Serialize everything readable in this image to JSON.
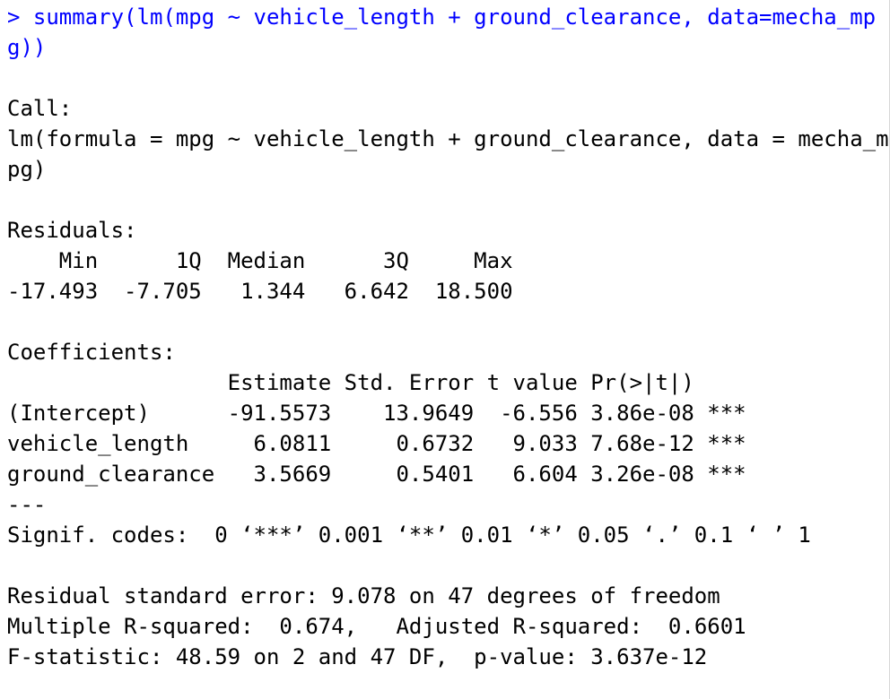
{
  "console": {
    "command_line_1": "> summary(lm(mpg ~ vehicle_length + ground_clearance, data=mecha_mp",
    "command_line_2": "g))",
    "call_header": "Call:",
    "call_line_1": "lm(formula = mpg ~ vehicle_length + ground_clearance, data = mecha_m",
    "call_line_2": "pg)",
    "residuals_header": "Residuals:",
    "residuals_labels": "    Min      1Q  Median      3Q     Max ",
    "residuals_values": "-17.493  -7.705   1.344   6.642  18.500 ",
    "coefficients_header": "Coefficients:",
    "coef_columns": "                 Estimate Std. Error t value Pr(>|t|)    ",
    "coef_rows": [
      "(Intercept)      -91.5573    13.9649  -6.556 3.86e-08 ***",
      "vehicle_length     6.0811     0.6732   9.033 7.68e-12 ***",
      "ground_clearance   3.5669     0.5401   6.604 3.26e-08 ***"
    ],
    "separator": "---",
    "signif_codes": "Signif. codes:  0 ‘***’ 0.001 ‘**’ 0.01 ‘*’ 0.05 ‘.’ 0.1 ‘ ’ 1",
    "rse_line": "Residual standard error: 9.078 on 47 degrees of freedom",
    "r2_line": "Multiple R-squared:  0.674,\tAdjusted R-squared:  0.6601 ",
    "f_line": "F-statistic: 48.59 on 2 and 47 DF,  p-value: 3.637e-12"
  },
  "colors": {
    "command": "#0000ff",
    "output": "#000000",
    "background": "#ffffff"
  }
}
